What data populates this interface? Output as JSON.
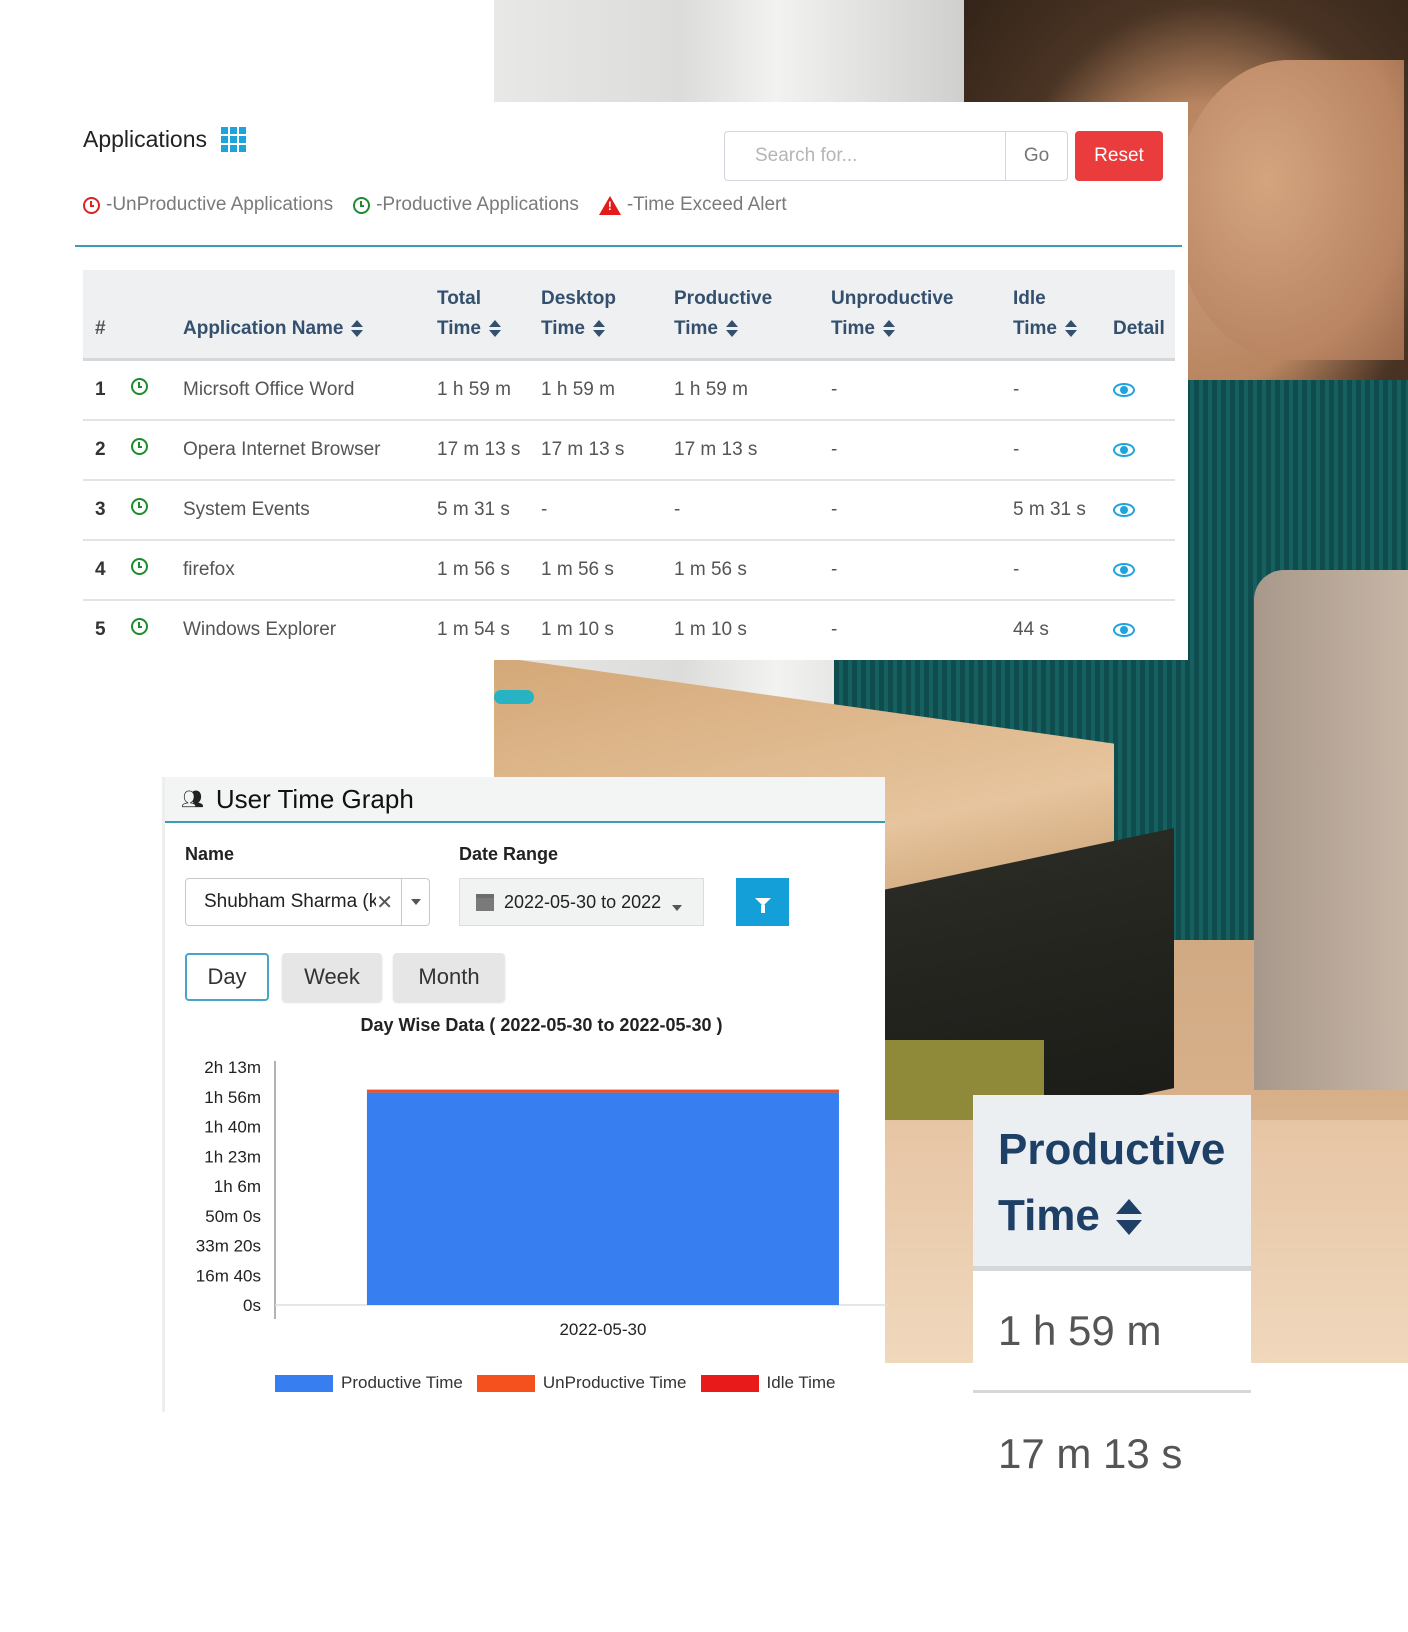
{
  "applications": {
    "title": "Applications",
    "title_icon": "grid-icon",
    "search": {
      "placeholder": "Search for...",
      "value": ""
    },
    "go_label": "Go",
    "reset_label": "Reset",
    "legend": [
      {
        "icon": "clock-icon",
        "color": "#dd2222",
        "label": "-UnProductive Applications"
      },
      {
        "icon": "clock-icon",
        "color": "#1e8b2e",
        "label": "-Productive Applications"
      },
      {
        "icon": "warning-icon",
        "color": "#e31b1b",
        "label": "-Time Exceed Alert"
      }
    ],
    "columns": {
      "num": "#",
      "name": "Application Name",
      "total_1": "Total",
      "total_2": "Time",
      "desktop_1": "Desktop",
      "desktop_2": "Time",
      "productive_1": "Productive",
      "productive_2": "Time",
      "unproductive_1": "Unproductive",
      "unproductive_2": "Time",
      "idle_1": "Idle",
      "idle_2": "Time",
      "detail": "Detail"
    },
    "rows": [
      {
        "num": "1",
        "status": "productive",
        "name": "Micrsoft Office Word",
        "total": "1 h 59 m",
        "desktop": "1 h 59 m",
        "productive": "1 h 59 m",
        "unproductive": "-",
        "idle": "-"
      },
      {
        "num": "2",
        "status": "productive",
        "name": "Opera Internet Browser",
        "total": "17 m 13 s",
        "desktop": "17 m 13 s",
        "productive": "17 m 13 s",
        "unproductive": "-",
        "idle": "-"
      },
      {
        "num": "3",
        "status": "productive",
        "name": "System Events",
        "total": "5 m 31 s",
        "desktop": "-",
        "productive": "-",
        "unproductive": "-",
        "idle": "5 m 31 s"
      },
      {
        "num": "4",
        "status": "productive",
        "name": "firefox",
        "total": "1 m 56 s",
        "desktop": "1 m 56 s",
        "productive": "1 m 56 s",
        "unproductive": "-",
        "idle": "-"
      },
      {
        "num": "5",
        "status": "productive",
        "name": "Windows Explorer",
        "total": "1 m 54 s",
        "desktop": "1 m 10 s",
        "productive": "1 m 10 s",
        "unproductive": "-",
        "idle": "44 s"
      }
    ]
  },
  "user_time_graph": {
    "title": "User Time Graph",
    "name_label": "Name",
    "name_value": "Shubham Sharma (k",
    "date_range_label": "Date Range",
    "date_range_value": "2022-05-30 to 2022",
    "tabs": [
      {
        "label": "Day",
        "active": true
      },
      {
        "label": "Week",
        "active": false
      },
      {
        "label": "Month",
        "active": false
      }
    ],
    "chart_title": "Day Wise Data ( 2022-05-30 to 2022-05-30 )"
  },
  "chart_data": {
    "type": "bar",
    "stacked": true,
    "title": "Day Wise Data ( 2022-05-30 to 2022-05-30 )",
    "categories": [
      "2022-05-30"
    ],
    "series": [
      {
        "name": "Productive Time",
        "color": "#377ff0",
        "values_seconds": [
          7140
        ]
      },
      {
        "name": "UnProductive Time",
        "color": "#f4511e",
        "values_seconds": [
          0
        ]
      },
      {
        "name": "Idle Time",
        "color": "#e81a1a",
        "values_seconds": [
          0
        ]
      }
    ],
    "xlabel": "",
    "ylabel": "",
    "ylim_seconds": [
      0,
      8000
    ],
    "y_ticks": [
      "0s",
      "16m 40s",
      "33m 20s",
      "50m 0s",
      "1h 6m",
      "1h 23m",
      "1h 40m",
      "1h 56m",
      "2h 13m"
    ],
    "y_tick_values_seconds": [
      0,
      1000,
      2000,
      3000,
      4000,
      5000,
      6000,
      7000,
      8000
    ],
    "legend_position": "bottom",
    "grid": false
  },
  "callout": {
    "header_1": "Productive",
    "header_2": "Time",
    "rows": [
      "1 h 59 m",
      "17 m 13 s"
    ]
  }
}
